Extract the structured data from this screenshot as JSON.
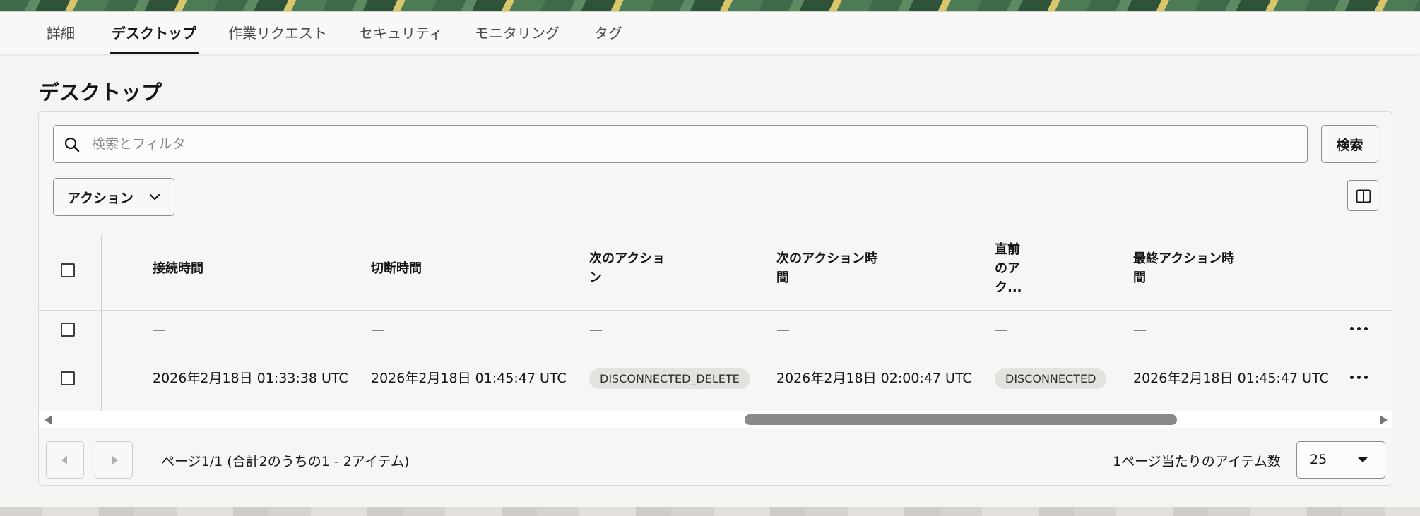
{
  "tabs": [
    {
      "label": "詳細",
      "active": false
    },
    {
      "label": "デスクトップ",
      "active": true
    },
    {
      "label": "作業リクエスト",
      "active": false
    },
    {
      "label": "セキュリティ",
      "active": false
    },
    {
      "label": "モニタリング",
      "active": false
    },
    {
      "label": "タグ",
      "active": false
    }
  ],
  "page": {
    "title": "デスクトップ"
  },
  "search": {
    "placeholder": "検索とフィルタ",
    "value": "",
    "button": "検索",
    "icon": "search-icon"
  },
  "toolbar": {
    "actions_label": "アクション",
    "columns_icon": "columns-icon"
  },
  "table": {
    "columns": [
      {
        "lines": [
          "接続時間"
        ]
      },
      {
        "lines": [
          "切断時間"
        ]
      },
      {
        "lines": [
          "次のアクショ",
          "ン"
        ]
      },
      {
        "lines": [
          "次のアクション時",
          "間"
        ]
      },
      {
        "lines": [
          "直前",
          "のア",
          "ク..."
        ]
      },
      {
        "lines": [
          "最終アクション時",
          "間"
        ]
      }
    ],
    "rows": [
      {
        "connect_time": "—",
        "disconnect_time": "—",
        "next_action": "—",
        "next_action_time": "—",
        "last_action": "—",
        "last_action_time": "—"
      },
      {
        "connect_time": "2026年2月18日 01:33:38 UTC",
        "disconnect_time": "2026年2月18日 01:45:47 UTC",
        "next_action": "DISCONNECTED_DELETE",
        "next_action_time": "2026年2月18日 02:00:47 UTC",
        "last_action": "DISCONNECTED",
        "last_action_time": "2026年2月18日 01:45:47 UTC"
      }
    ]
  },
  "pagination": {
    "summary": "ページ1/1 (合計2のうちの1 - 2アイテム)",
    "per_page_label": "1ページ当たりのアイテム数",
    "per_page_value": "25"
  },
  "colors": {
    "accent": "#161513",
    "pill_bg": "#e4e2de",
    "page_bg": "#f5f4f2"
  }
}
